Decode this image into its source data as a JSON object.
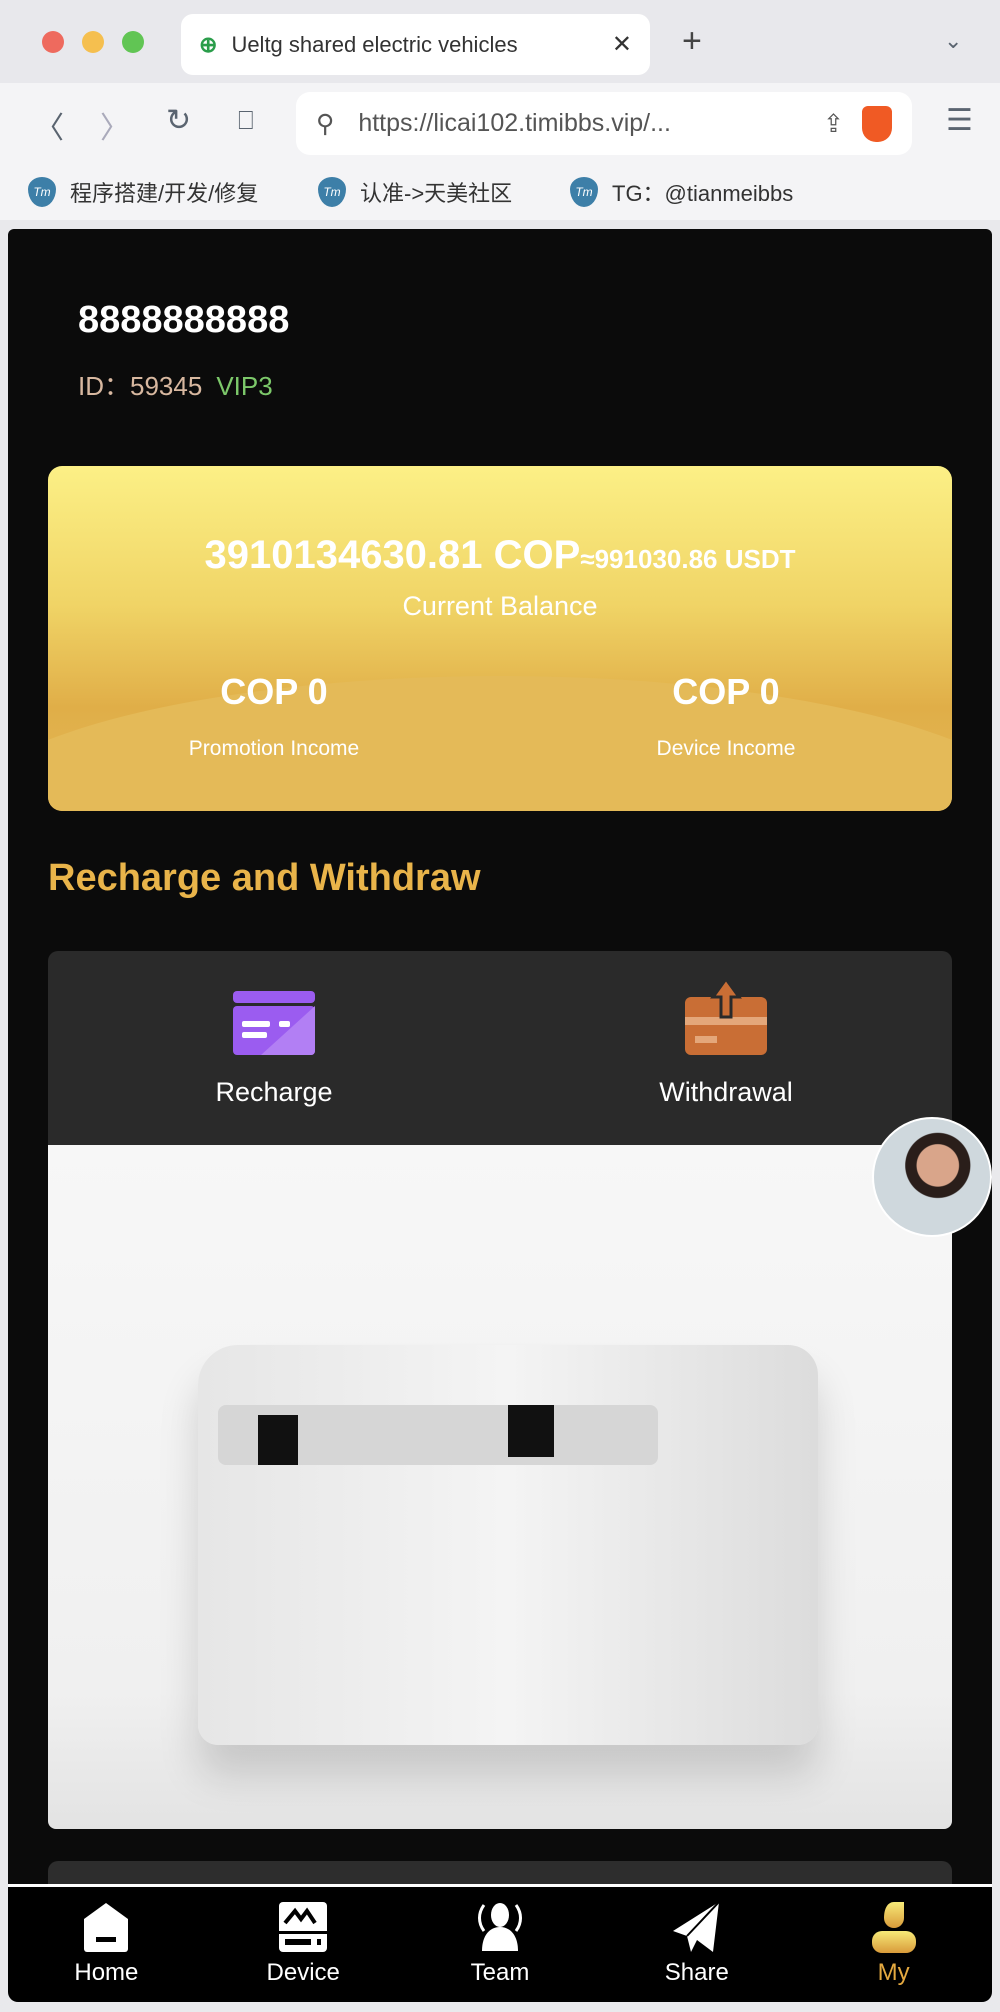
{
  "browser": {
    "tab_title": "Ueltg shared electric vehicles",
    "url": "https://licai102.timibbs.vip/...",
    "bookmarks": [
      {
        "label": "程序搭建/开发/修复"
      },
      {
        "label": "认准->天美社区"
      },
      {
        "label": "TG：@tianmeibbs"
      }
    ]
  },
  "profile": {
    "username": "8888888888",
    "id_label": "ID：",
    "id": "59345",
    "vip": "VIP3"
  },
  "balance": {
    "amount": "3910134630.81 COP",
    "usdt": "≈991030.86 USDT",
    "label": "Current Balance",
    "promotion_value": "COP 0",
    "promotion_label": "Promotion Income",
    "device_value": "COP 0",
    "device_label": "Device Income"
  },
  "section_title": "Recharge and Withdraw",
  "actions": [
    {
      "label": "Recharge",
      "icon": "credit-card-icon",
      "color": "#9b5cf0"
    },
    {
      "label": "Withdrawal",
      "icon": "box-upload-icon",
      "color": "#c96e35"
    }
  ],
  "nav": [
    {
      "label": "Home",
      "icon": "home-icon"
    },
    {
      "label": "Device",
      "icon": "device-icon"
    },
    {
      "label": "Team",
      "icon": "team-icon"
    },
    {
      "label": "Share",
      "icon": "paper-plane-icon"
    },
    {
      "label": "My",
      "icon": "user-icon",
      "active": true
    }
  ],
  "colors": {
    "accent": "#e9b44a",
    "vip": "#7cc86a",
    "background": "#0b0b0b"
  }
}
